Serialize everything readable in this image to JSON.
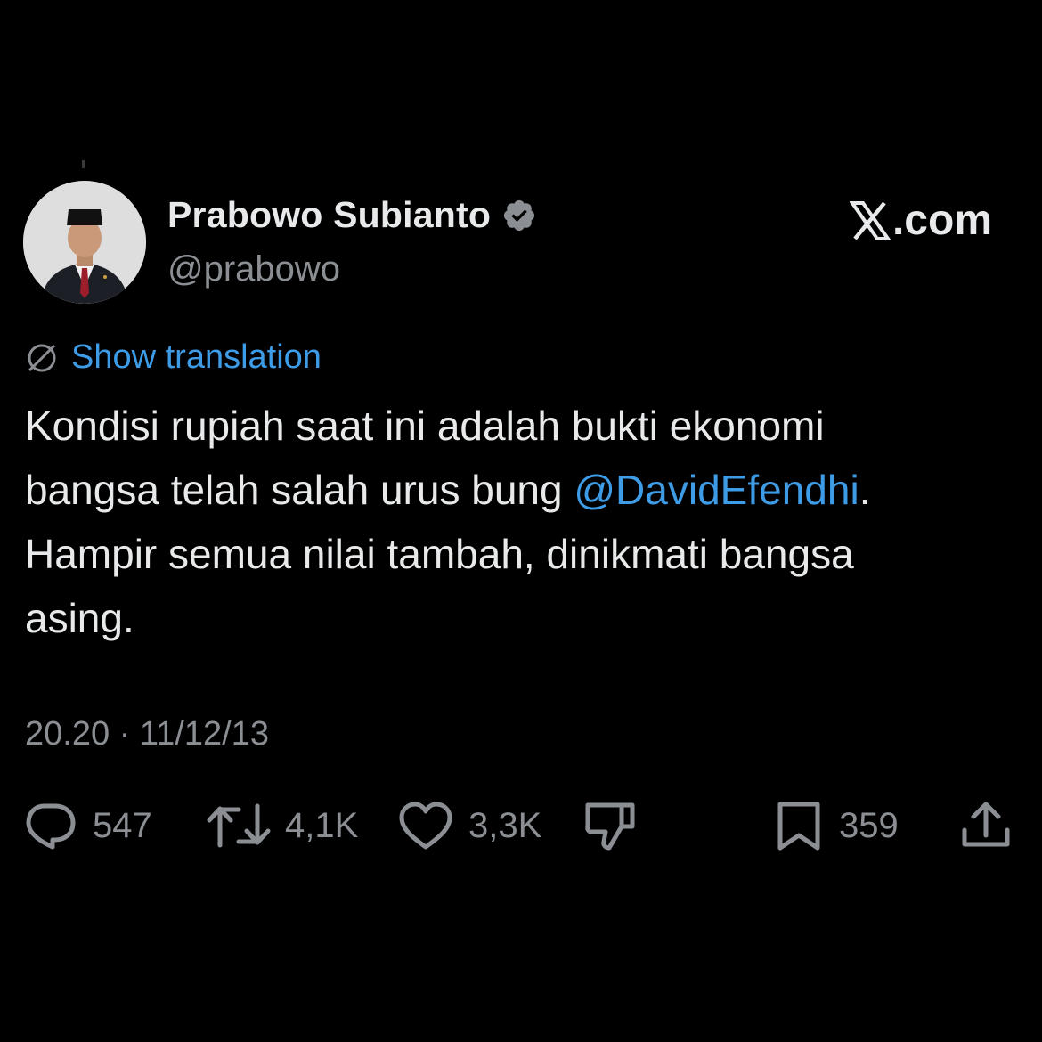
{
  "author": {
    "display_name": "Prabowo Subianto",
    "handle": "@prabowo",
    "verified_icon": "verified-badge-icon",
    "avatar": "profile-photo"
  },
  "brand": {
    "text": ".com",
    "logo_icon": "x-logo-icon"
  },
  "translation": {
    "icon": "globe-icon",
    "label": "Show translation"
  },
  "tweet": {
    "line1": "Kondisi rupiah saat ini adalah bukti ekonomi",
    "line2_prefix": "bangsa telah salah urus bung ",
    "line2_mention": "@DavidEfendhi",
    "line2_suffix": ".",
    "line3": "Hampir semua nilai tambah, dinikmati bangsa",
    "line4": "asing."
  },
  "timestamp": "20.20 · 11/12/13",
  "actions": {
    "reply": {
      "icon": "reply-icon",
      "count": "547"
    },
    "repost": {
      "icon": "repost-icon",
      "count": "4,1K"
    },
    "like": {
      "icon": "heart-icon",
      "count": "3,3K"
    },
    "dislike": {
      "icon": "thumbs-down-icon"
    },
    "bookmark": {
      "icon": "bookmark-icon",
      "count": "359"
    },
    "share": {
      "icon": "share-icon"
    }
  },
  "colors": {
    "background": "#000000",
    "text_primary": "#e7e9ea",
    "text_secondary": "#8b8f94",
    "link": "#3e9be6"
  }
}
